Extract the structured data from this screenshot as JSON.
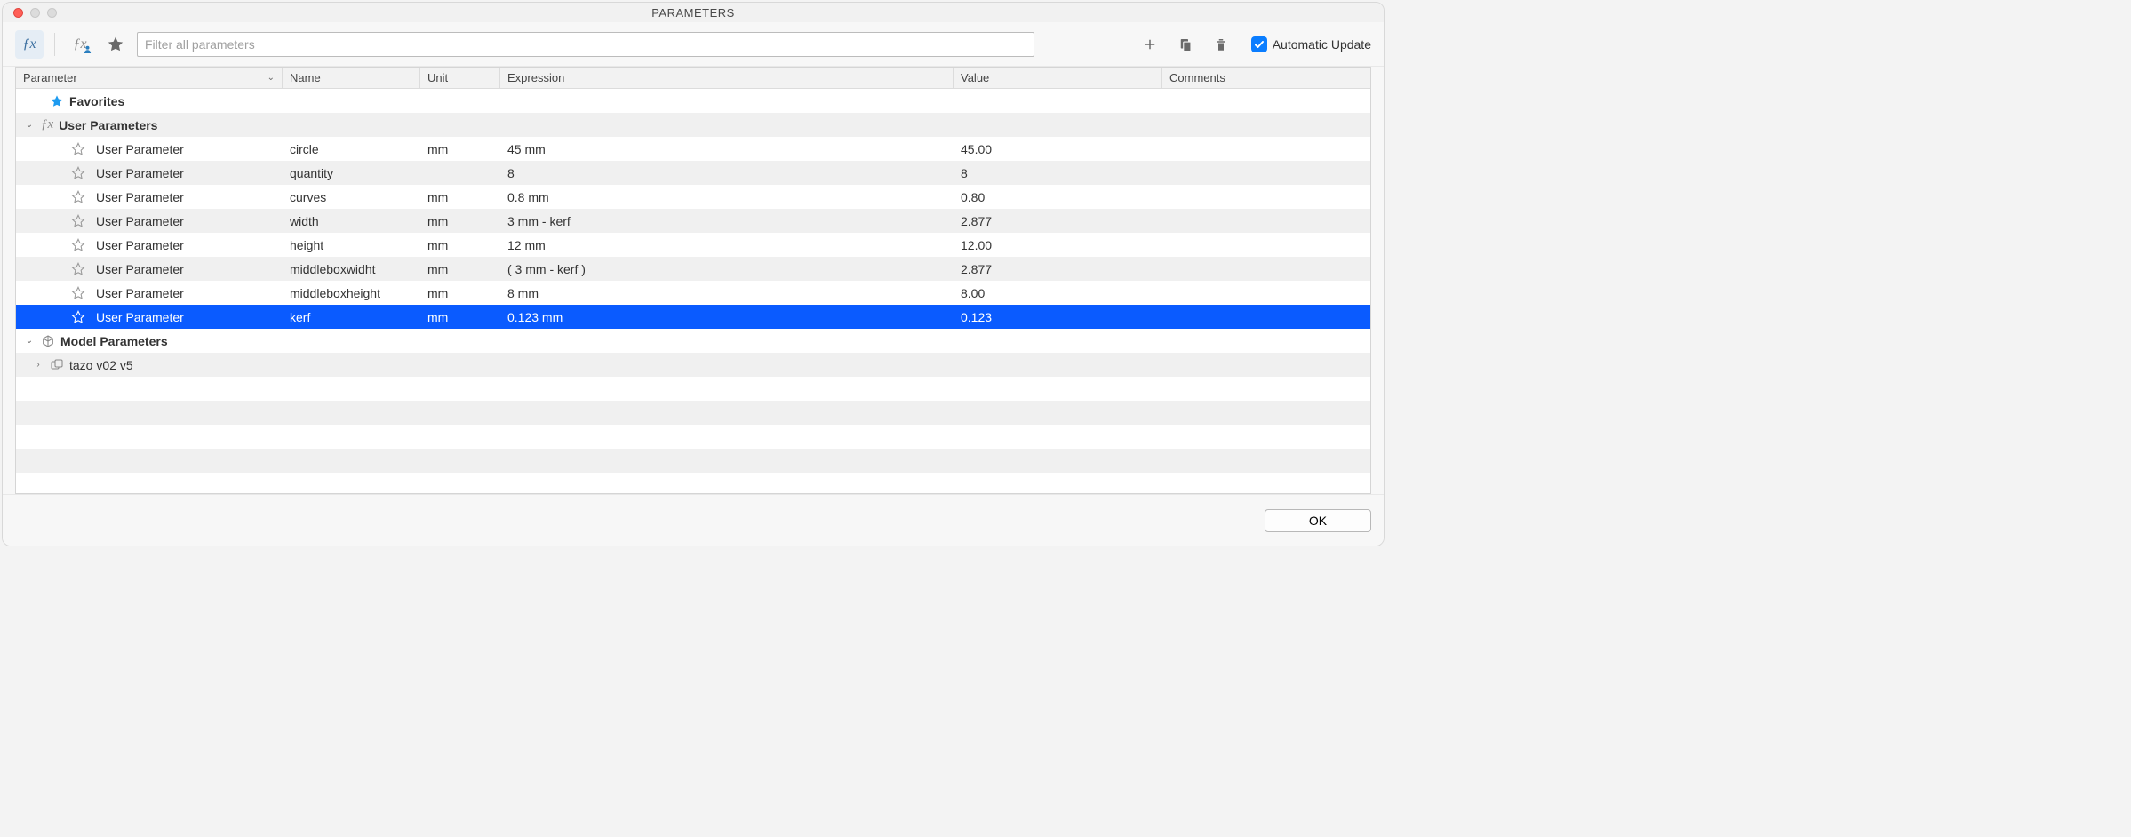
{
  "window": {
    "title": "PARAMETERS"
  },
  "toolbar": {
    "search_placeholder": "Filter all parameters",
    "search_value": "",
    "auto_update_label": "Automatic Update",
    "auto_update_checked": true
  },
  "columns": {
    "parameter": "Parameter",
    "name": "Name",
    "unit": "Unit",
    "expression": "Expression",
    "value": "Value",
    "comments": "Comments"
  },
  "groups": {
    "favorites": {
      "label": "Favorites"
    },
    "user_params": {
      "label": "User Parameters",
      "expanded": true
    },
    "model_params": {
      "label": "Model Parameters",
      "expanded": true
    },
    "model_child": {
      "label": "tazo v02 v5",
      "expanded": false
    }
  },
  "rows": [
    {
      "type": "User Parameter",
      "name": "circle",
      "unit": "mm",
      "expression": "45 mm",
      "value": "45.00",
      "comments": "",
      "favorite": false
    },
    {
      "type": "User Parameter",
      "name": "quantity",
      "unit": "",
      "expression": "8",
      "value": "8",
      "comments": "",
      "favorite": false
    },
    {
      "type": "User Parameter",
      "name": "curves",
      "unit": "mm",
      "expression": "0.8 mm",
      "value": "0.80",
      "comments": "",
      "favorite": false
    },
    {
      "type": "User Parameter",
      "name": "width",
      "unit": "mm",
      "expression": "3 mm - kerf",
      "value": "2.877",
      "comments": "",
      "favorite": false
    },
    {
      "type": "User Parameter",
      "name": "height",
      "unit": "mm",
      "expression": "12 mm",
      "value": "12.00",
      "comments": "",
      "favorite": false
    },
    {
      "type": "User Parameter",
      "name": "middleboxwidht",
      "unit": "mm",
      "expression": "( 3 mm - kerf )",
      "value": "2.877",
      "comments": "",
      "favorite": false
    },
    {
      "type": "User Parameter",
      "name": "middleboxheight",
      "unit": "mm",
      "expression": "8 mm",
      "value": "8.00",
      "comments": "",
      "favorite": false
    },
    {
      "type": "User Parameter",
      "name": "kerf",
      "unit": "mm",
      "expression": "0.123 mm",
      "value": "0.123",
      "comments": "",
      "favorite": false,
      "selected": true
    }
  ],
  "footer": {
    "ok_label": "OK"
  }
}
